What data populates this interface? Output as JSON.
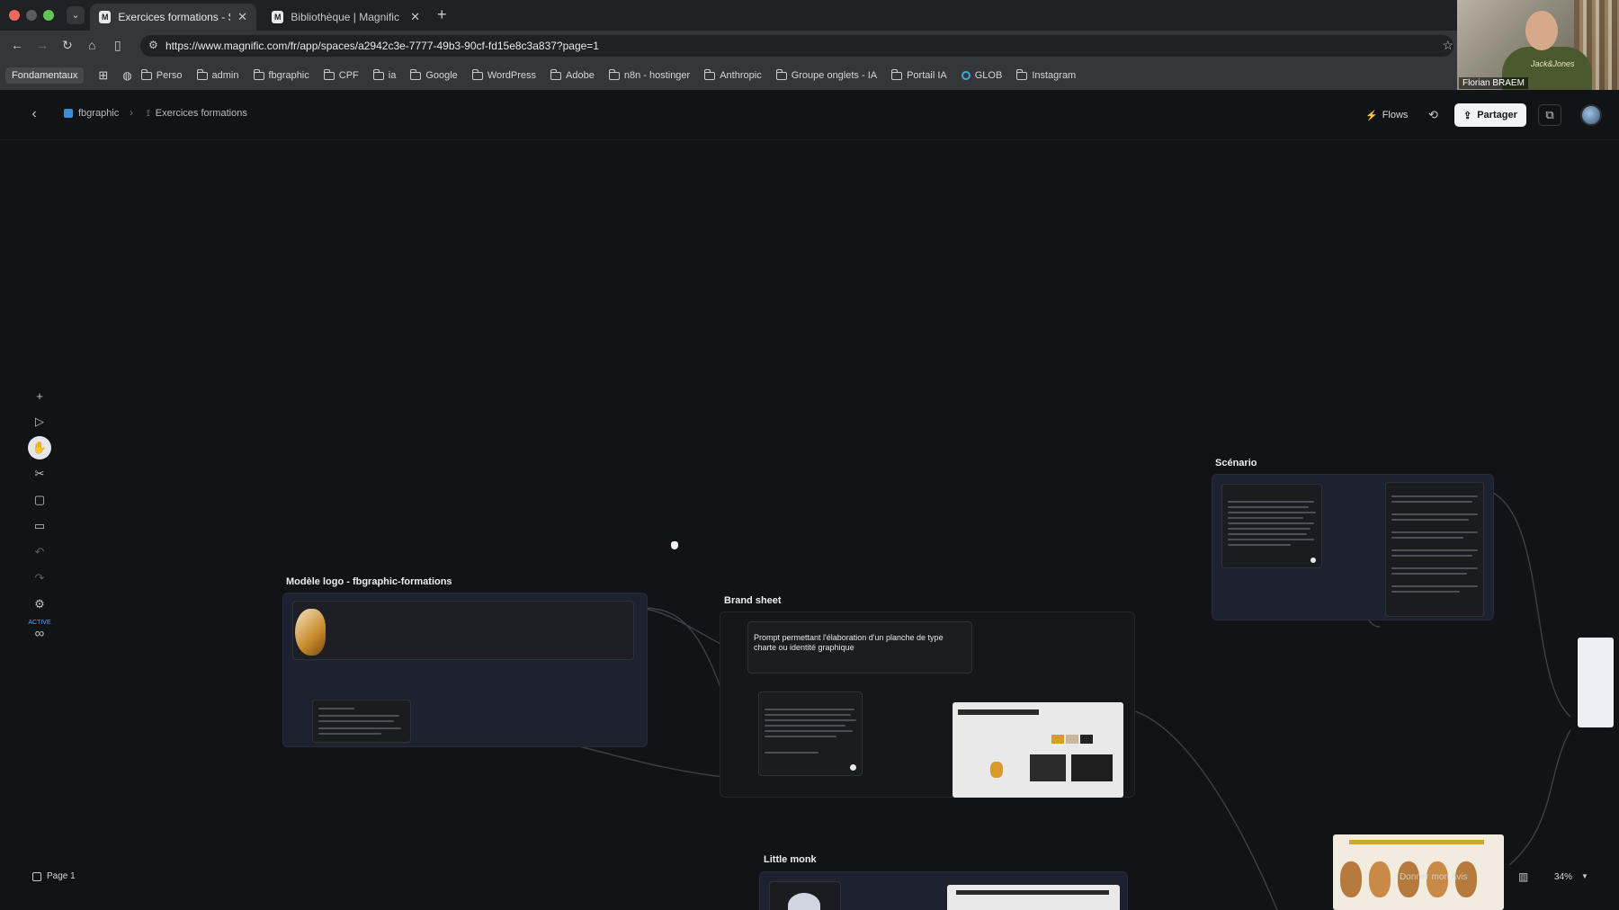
{
  "browser": {
    "tabs": [
      {
        "title": "Exercices formations - Space",
        "active": true
      },
      {
        "title": "Bibliothèque | Magnific IA",
        "active": false
      }
    ],
    "url": "https://www.magnific.com/fr/app/spaces/a2942c3e-7777-49b3-90cf-fd15e8c3a837?page=1",
    "bookmarks": [
      "Fondamentaux",
      "Perso",
      "admin",
      "fbgraphic",
      "CPF",
      "ia",
      "Google",
      "WordPress",
      "Adobe",
      "n8n - hostinger",
      "Anthropic",
      "Groupe onglets - IA",
      "Portail IA",
      "GLOB",
      "Instagram"
    ]
  },
  "webcam": {
    "name": "Florian BRAEM"
  },
  "header": {
    "breadcrumb": [
      "fbgraphic",
      "Exercices formations"
    ],
    "flows_label": "Flows",
    "share_label": "Partager"
  },
  "toolbar": {
    "tools": [
      "plus-icon",
      "play-icon",
      "hand-icon",
      "scissors-icon",
      "note-icon",
      "comment-icon",
      "undo-icon",
      "redo-icon",
      "settings-icon"
    ],
    "active_label": "ACTIVE"
  },
  "canvas": {
    "groups": {
      "logo": "Modèle logo - fbgraphic-formations",
      "brand": "Brand sheet",
      "scenario": "Scénario",
      "monk": "Little monk"
    },
    "prompt_text": "Prompt permettant l'élaboration d'un planche de type charte ou identité graphique"
  },
  "footer": {
    "page_label": "Page 1",
    "feedback_label": "Donner mon avis",
    "zoom": "34%"
  }
}
